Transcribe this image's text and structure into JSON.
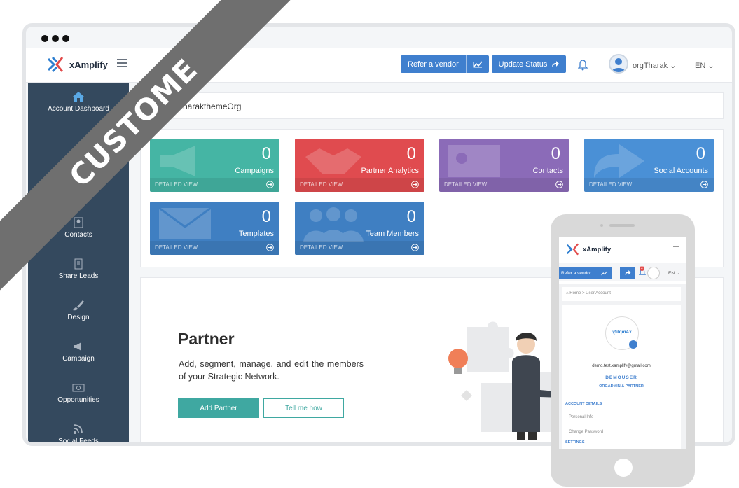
{
  "ribbon": {
    "text": "CUSTOME"
  },
  "app": {
    "logo_text": "xAmplify"
  },
  "header": {
    "refer_label": "Refer a vendor",
    "update_label": "Update Status",
    "user_name": "orgTharak",
    "language": "EN"
  },
  "sidebar": {
    "items": [
      {
        "label": "Account Dashboard",
        "icon": "home-icon"
      },
      {
        "label": "Contacts",
        "icon": "contacts-icon"
      },
      {
        "label": "Share Leads",
        "icon": "share-leads-icon"
      },
      {
        "label": "Design",
        "icon": "brush-icon"
      },
      {
        "label": "Campaign",
        "icon": "megaphone-icon"
      },
      {
        "label": "Opportunities",
        "icon": "money-icon"
      },
      {
        "label": "Social Feeds",
        "icon": "rss-icon"
      }
    ]
  },
  "breadcrumb": {
    "text": "harakthemeOrg"
  },
  "cards": [
    {
      "title": "Campaigns",
      "count": "0",
      "footer": "DETAILED VIEW",
      "color": "#45b5a4"
    },
    {
      "title": "Partner Analytics",
      "count": "0",
      "footer": "DETAILED VIEW",
      "color": "#e04b4f"
    },
    {
      "title": "Contacts",
      "count": "0",
      "footer": "DETAILED VIEW",
      "color": "#8b6bb8"
    },
    {
      "title": "Social Accounts",
      "count": "0",
      "footer": "DETAILED VIEW",
      "color": "#4a90d6"
    },
    {
      "title": "Templates",
      "count": "0",
      "footer": "DETAILED VIEW",
      "color": "#3f7fc2"
    },
    {
      "title": "Team Members",
      "count": "0",
      "footer": "DETAILED VIEW",
      "color": "#3f7fc2"
    }
  ],
  "partner": {
    "title": "Partner",
    "description": "Add, segment, manage, and edit the members of your Strategic Network.",
    "add_label": "Add Partner",
    "tell_label": "Tell me how"
  },
  "mobile": {
    "logo_text": "xAmplify",
    "refer_label": "Refer a vendor",
    "language": "EN",
    "notification_count": "2",
    "breadcrumb_home": "Home",
    "breadcrumb_sep": ">",
    "breadcrumb_current": "User Account",
    "avatar_text": "xAmplify",
    "email": "demo.test.xamplify@gmail.com",
    "username": "DEMOUSER",
    "role": "ORGADMIN & PARTNER",
    "section_account": "ACCOUNT DETAILS",
    "link_personal": "Personal Info",
    "link_password": "Change Password",
    "section_settings": "SETTINGS"
  }
}
